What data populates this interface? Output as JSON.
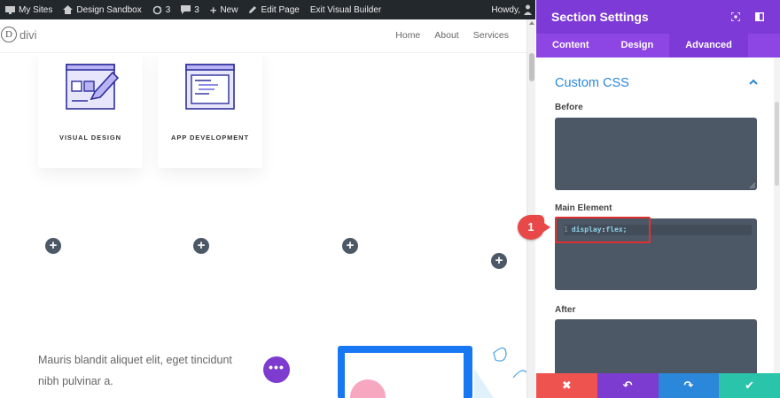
{
  "admin_bar": {
    "my_sites": "My Sites",
    "site_name": "Design Sandbox",
    "updates_count": "3",
    "comments_count": "3",
    "new_label": "New",
    "edit_page": "Edit Page",
    "exit_builder": "Exit Visual Builder",
    "howdy": "Howdy, "
  },
  "site": {
    "logo_text": "divi",
    "nav": [
      "Home",
      "About",
      "Services"
    ]
  },
  "content": {
    "cards": [
      {
        "label": "VISUAL DESIGN",
        "icon": "design-pencil-icon"
      },
      {
        "label": "APP DEVELOPMENT",
        "icon": "app-window-icon"
      }
    ],
    "paragraph": "Mauris blandit aliquet elit, eget tincidunt nibh pulvinar a.",
    "fab_label": "•••"
  },
  "settings_panel": {
    "title": "Section Settings",
    "tabs": [
      "Content",
      "Design",
      "Advanced"
    ],
    "active_tab": "Advanced",
    "section_title": "Custom CSS",
    "fields": {
      "before_label": "Before",
      "main_label": "Main Element",
      "after_label": "After"
    },
    "code": {
      "line_number": "1",
      "property": "display",
      "colon": ":",
      "value": "flex;"
    },
    "callout_number": "1",
    "footer": {
      "cancel": "✖",
      "undo": "↶",
      "redo": "↷",
      "save": "✔"
    }
  },
  "colors": {
    "panel_purple": "#7d3ad6",
    "cancel_red": "#ef5350",
    "undo_purple": "#7c3ccf",
    "redo_blue": "#2b87da",
    "save_teal": "#29c4a9"
  }
}
